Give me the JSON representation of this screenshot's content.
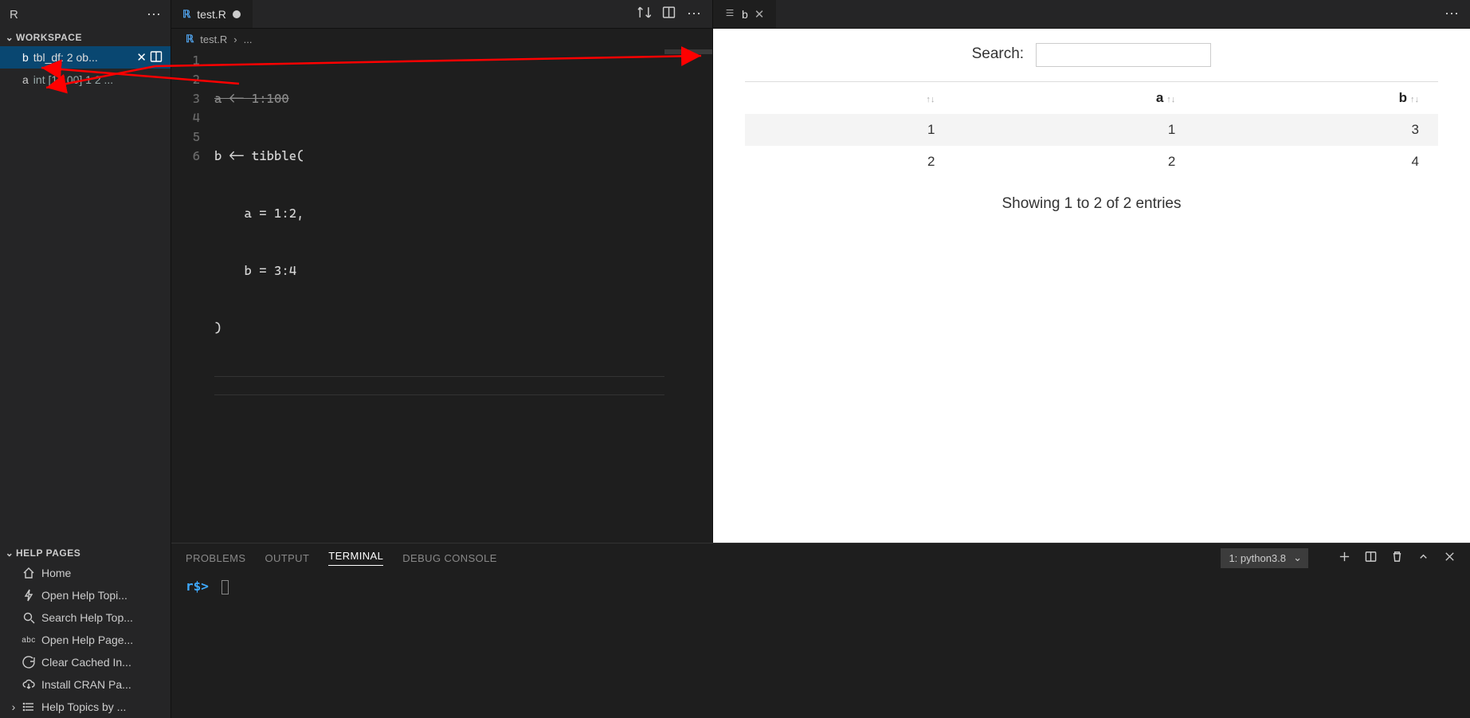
{
  "sidebar": {
    "title": "R",
    "workspace_label": "WORKSPACE",
    "items": [
      {
        "name": "b",
        "desc": "tbl_df: 2 ob...",
        "selected": true
      },
      {
        "name": "a",
        "desc": "int [1:100] 1 2 ...",
        "selected": false
      }
    ],
    "help_label": "HELP PAGES",
    "help_items": {
      "home": "Home",
      "open_topic": "Open Help Topi...",
      "search_topic": "Search Help Top...",
      "open_page": "Open Help Page...",
      "clear_cache": "Clear Cached In...",
      "install_cran": "Install CRAN Pa...",
      "topics_by": "Help Topics by ..."
    }
  },
  "editor": {
    "tab_label": "test.R",
    "breadcrumb_file": "test.R",
    "breadcrumb_more": "...",
    "lines": {
      "l1": "a <- 1:100",
      "l2": "b <- tibble(",
      "l3": "    a = 1:2,",
      "l4": "    b = 3:4",
      "l5": ")",
      "l6": ""
    },
    "gutter": [
      "1",
      "2",
      "3",
      "4",
      "5",
      "6"
    ]
  },
  "viewer": {
    "tab_label": "b",
    "search_label": "Search:",
    "columns": {
      "idx": "",
      "a": "a",
      "b": "b"
    },
    "rows": [
      {
        "idx": "1",
        "a": "1",
        "b": "3"
      },
      {
        "idx": "2",
        "a": "2",
        "b": "4"
      }
    ],
    "summary": "Showing 1 to 2 of 2 entries"
  },
  "panel": {
    "tabs": {
      "problems": "PROBLEMS",
      "output": "OUTPUT",
      "terminal": "TERMINAL",
      "debug": "DEBUG CONSOLE"
    },
    "term_select": "1: python3.8",
    "prompt": "r$>"
  }
}
